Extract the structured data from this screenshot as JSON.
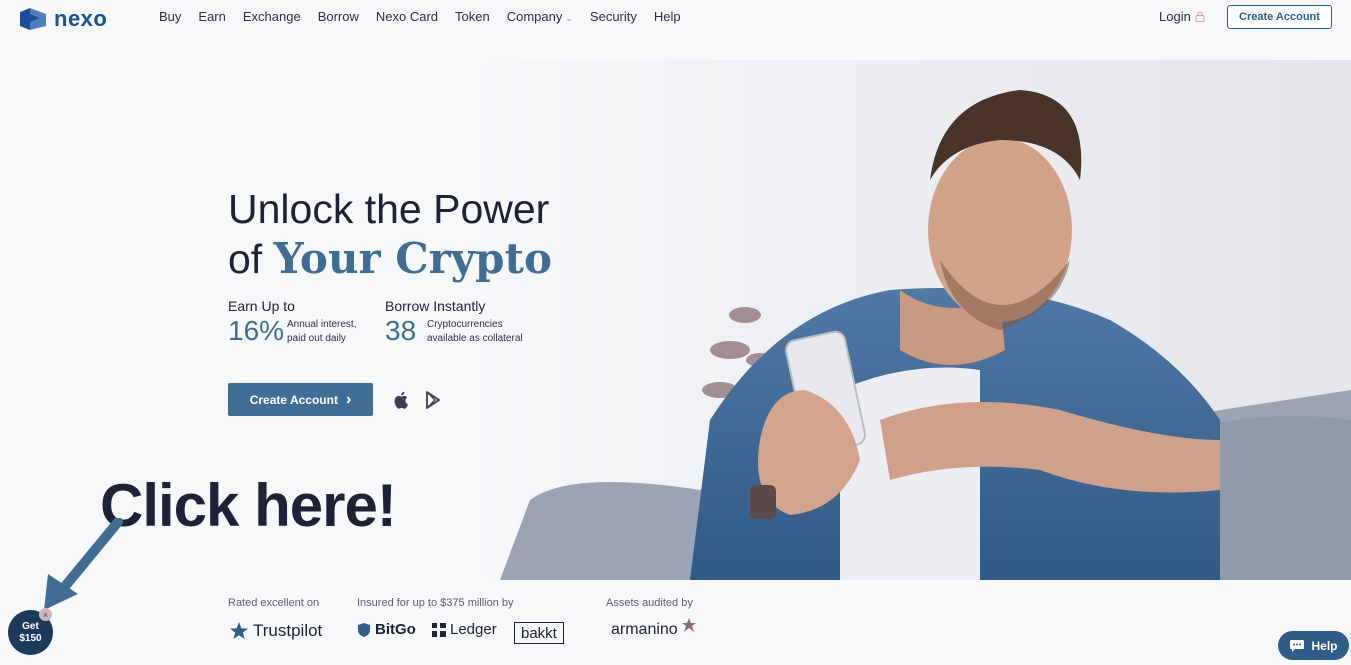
{
  "brand": {
    "name": "nexo"
  },
  "nav": {
    "items": [
      {
        "label": "Buy"
      },
      {
        "label": "Earn"
      },
      {
        "label": "Exchange"
      },
      {
        "label": "Borrow"
      },
      {
        "label": "Nexo Card"
      },
      {
        "label": "Token"
      },
      {
        "label": "Company"
      },
      {
        "label": "Security"
      },
      {
        "label": "Help"
      }
    ],
    "login": "Login",
    "create_account": "Create Account"
  },
  "hero": {
    "headline_line1": "Unlock the Power",
    "headline_of": "of ",
    "headline_accent": "Your Crypto",
    "stats": [
      {
        "title": "Earn Up to",
        "value": "16%",
        "desc_line1": "Annual interest,",
        "desc_line2": "paid out daily"
      },
      {
        "title": "Borrow Instantly",
        "value": "38",
        "desc_line1": "Cryptocurrencies",
        "desc_line2": "available as collateral"
      }
    ],
    "cta_label": "Create Account",
    "cta_chevron": "›"
  },
  "annotation": {
    "text": "Click here!"
  },
  "trust": {
    "rated_label": "Rated excellent on",
    "insured_label": "Insured for up to $375 million by",
    "audited_label": "Assets audited by",
    "trustpilot": "Trustpilot",
    "bitgo": "BitGo",
    "ledger": "Ledger",
    "bakkt": "bakkt",
    "armanino": "armanino"
  },
  "promo": {
    "line1": "Get",
    "line2": "$150",
    "close": "×"
  },
  "help": {
    "label": "Help"
  },
  "colors": {
    "accent": "#3e6d96",
    "brand": "#1a4fa0",
    "dark": "#1e2236"
  }
}
